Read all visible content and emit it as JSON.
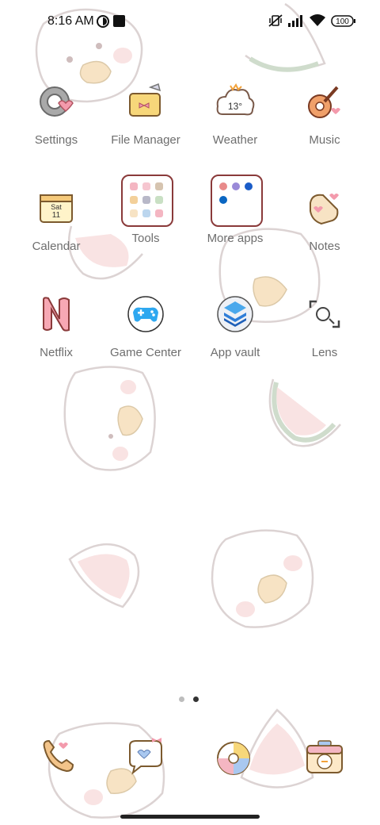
{
  "status_bar": {
    "time": "8:16 AM",
    "battery": "100",
    "icons": [
      "vpn-icon",
      "notification-square-icon",
      "mute-vibrate-icon",
      "signal-icon",
      "wifi-icon",
      "battery-icon"
    ]
  },
  "apps": [
    {
      "label": "Settings",
      "icon": "gear-heart-icon"
    },
    {
      "label": "File Manager",
      "icon": "folder-bow-icon"
    },
    {
      "label": "Weather",
      "icon": "cloud-sun-icon",
      "temp": "13°"
    },
    {
      "label": "Music",
      "icon": "guitar-icon"
    },
    {
      "label": "Calendar",
      "icon": "calendar-icon",
      "day": "Sat",
      "date": "11"
    },
    {
      "label": "Tools",
      "icon": "tools-folder-icon"
    },
    {
      "label": "More apps",
      "icon": "more-apps-folder-icon"
    },
    {
      "label": "Notes",
      "icon": "notes-icon"
    },
    {
      "label": "Netflix",
      "icon": "netflix-n-icon"
    },
    {
      "label": "Game Center",
      "icon": "gamepad-icon"
    },
    {
      "label": "App vault",
      "icon": "app-vault-icon"
    },
    {
      "label": "Lens",
      "icon": "lens-icon"
    }
  ],
  "page_indicator": {
    "pages": 2,
    "current": 2
  },
  "dock": [
    {
      "icon": "phone-icon"
    },
    {
      "icon": "messages-icon"
    },
    {
      "icon": "browser-icon"
    },
    {
      "icon": "camera-icon"
    }
  ],
  "colors": {
    "label": "#6e6e6e",
    "accent_pink": "#f4b6c2",
    "accent_cream": "#f7e3c4"
  }
}
